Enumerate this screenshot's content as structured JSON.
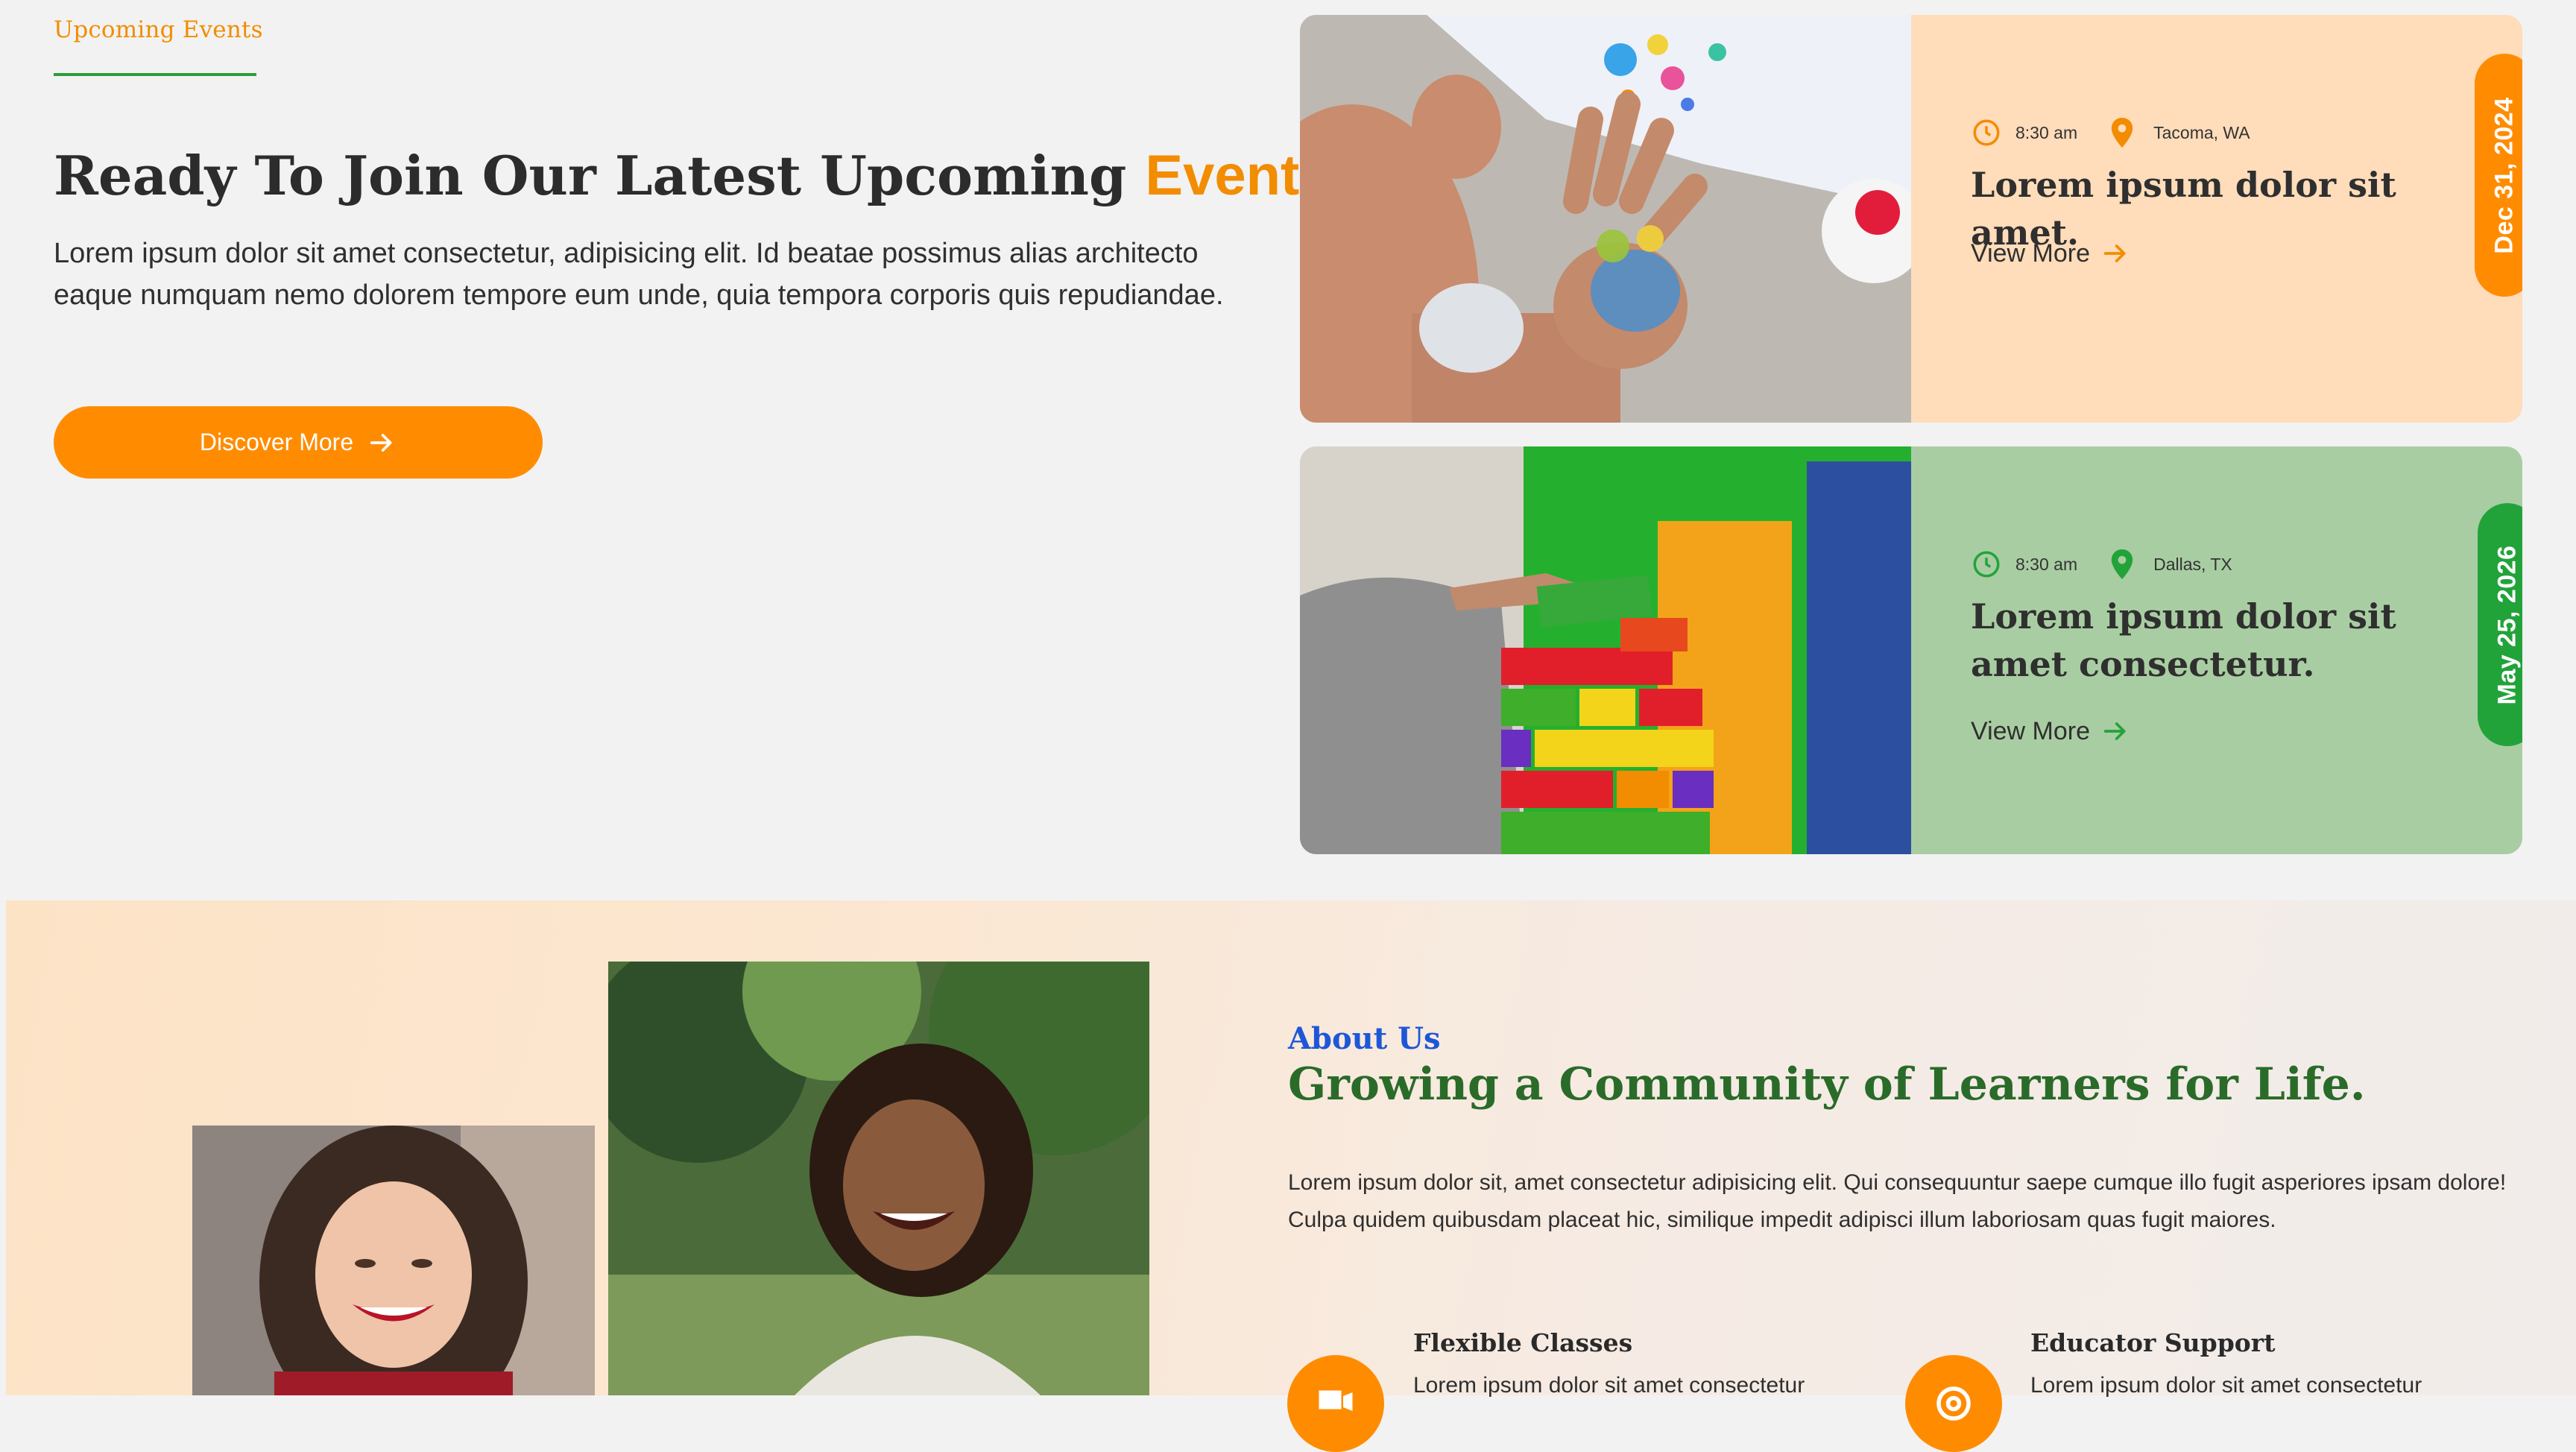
{
  "events_section": {
    "eyebrow": "Upcoming Events",
    "headline": "Ready To Join Our Latest Upcoming",
    "headline_accent": "Events?",
    "description": "Lorem ipsum dolor sit amet consectetur, adipisicing elit. Id beatae possimus alias architecto eaque numquam nemo dolorem tempore eum unde, quia tempora corporis quis repudiandae.",
    "cta_label": "Discover More",
    "cta_icon": "arrow-right-icon"
  },
  "events": [
    {
      "time": "8:30 am",
      "location": "Tacoma, WA",
      "title": "Lorem ipsum dolor sit amet.",
      "link_label": "View More",
      "date": "Dec 31, 2024",
      "card_color": "#ffdcba",
      "accent": "#ff8c00"
    },
    {
      "time": "8:30 am",
      "location": "Dallas, TX",
      "title": "Lorem ipsum dolor sit amet consectetur.",
      "link_label": "View More",
      "date": "May 25, 2026",
      "card_color": "#a9cda2",
      "accent": "#22a33a"
    }
  ],
  "about_section": {
    "eyebrow": "About Us",
    "title": "Growing a Community of Learners for Life.",
    "description": "Lorem ipsum dolor sit, amet consectetur adipisicing elit. Qui consequuntur saepe cumque illo fugit asperiores ipsam dolore! Culpa quidem quibusdam placeat hic, similique impedit adipisci illum laboriosam quas fugit maiores.",
    "features": [
      {
        "title": "Flexible Classes",
        "text": "Lorem ipsum dolor sit amet consectetur",
        "icon": "classes-icon"
      },
      {
        "title": "Educator Support",
        "text": "Lorem ipsum dolor sit amet consectetur",
        "icon": "support-icon"
      }
    ]
  },
  "colors": {
    "brand_orange": "#ff8c00",
    "brand_green": "#2f9c3a",
    "about_blue": "#1e56d8",
    "about_green": "#2a6b2a"
  }
}
